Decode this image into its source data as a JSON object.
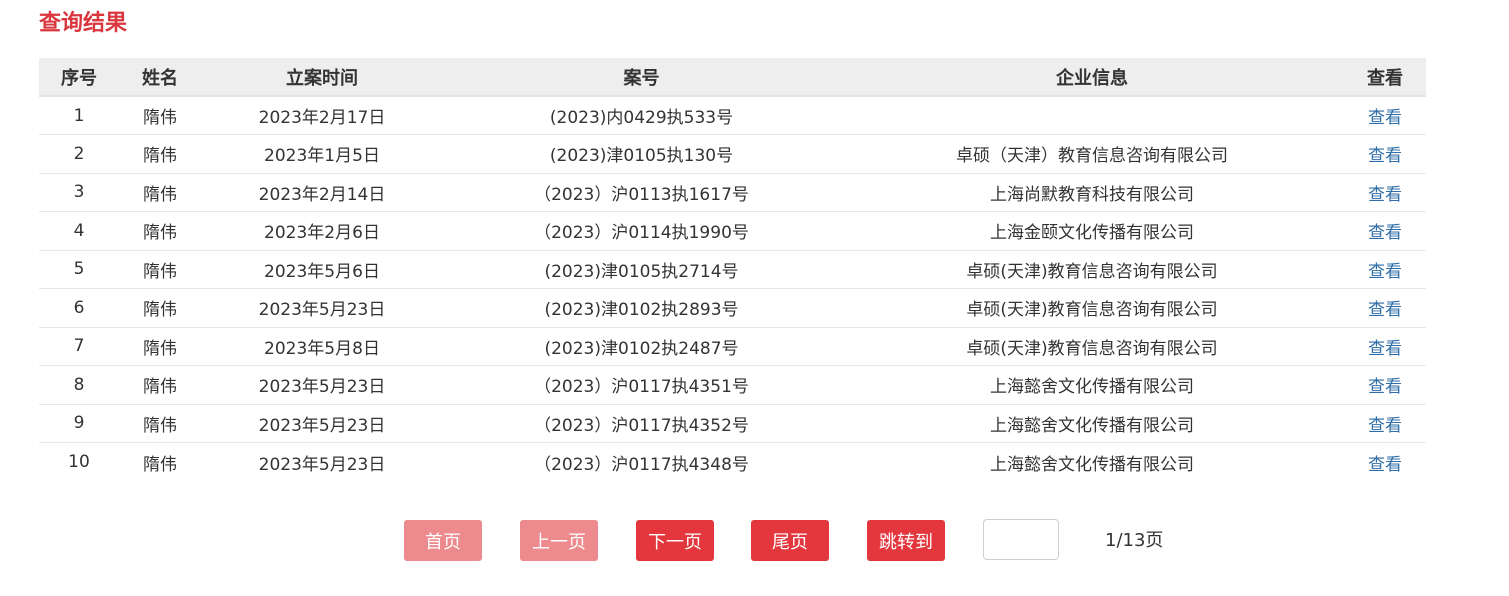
{
  "page": {
    "title": "查询结果"
  },
  "table": {
    "headers": {
      "index": "序号",
      "name": "姓名",
      "date": "立案时间",
      "case_no": "案号",
      "company": "企业信息",
      "view": "查看"
    },
    "rows": [
      {
        "index": "1",
        "name": "隋伟",
        "date": "2023年2月17日",
        "case_no": "(2023)内0429执533号",
        "company": "",
        "view": "查看"
      },
      {
        "index": "2",
        "name": "隋伟",
        "date": "2023年1月5日",
        "case_no": "(2023)津0105执130号",
        "company": "卓硕（天津）教育信息咨询有限公司",
        "view": "查看"
      },
      {
        "index": "3",
        "name": "隋伟",
        "date": "2023年2月14日",
        "case_no": "（2023）沪0113执1617号",
        "company": "上海尚默教育科技有限公司",
        "view": "查看"
      },
      {
        "index": "4",
        "name": "隋伟",
        "date": "2023年2月6日",
        "case_no": "（2023）沪0114执1990号",
        "company": "上海金颐文化传播有限公司",
        "view": "查看"
      },
      {
        "index": "5",
        "name": "隋伟",
        "date": "2023年5月6日",
        "case_no": "(2023)津0105执2714号",
        "company": "卓硕(天津)教育信息咨询有限公司",
        "view": "查看"
      },
      {
        "index": "6",
        "name": "隋伟",
        "date": "2023年5月23日",
        "case_no": "(2023)津0102执2893号",
        "company": "卓硕(天津)教育信息咨询有限公司",
        "view": "查看"
      },
      {
        "index": "7",
        "name": "隋伟",
        "date": "2023年5月8日",
        "case_no": "(2023)津0102执2487号",
        "company": "卓硕(天津)教育信息咨询有限公司",
        "view": "查看"
      },
      {
        "index": "8",
        "name": "隋伟",
        "date": "2023年5月23日",
        "case_no": "（2023）沪0117执4351号",
        "company": "上海懿舍文化传播有限公司",
        "view": "查看"
      },
      {
        "index": "9",
        "name": "隋伟",
        "date": "2023年5月23日",
        "case_no": "（2023）沪0117执4352号",
        "company": "上海懿舍文化传播有限公司",
        "view": "查看"
      },
      {
        "index": "10",
        "name": "隋伟",
        "date": "2023年5月23日",
        "case_no": "（2023）沪0117执4348号",
        "company": "上海懿舍文化传播有限公司",
        "view": "查看"
      }
    ]
  },
  "pagination": {
    "first": "首页",
    "prev": "上一页",
    "next": "下一页",
    "last": "尾页",
    "jump": "跳转到",
    "jump_value": "",
    "page_info": "1/13页"
  },
  "colors": {
    "title": "#d9363e",
    "button_active": "#e3363d",
    "button_disabled": "#ec8a8d",
    "link": "#2f6ea8",
    "header_bg": "#eeeeee"
  }
}
